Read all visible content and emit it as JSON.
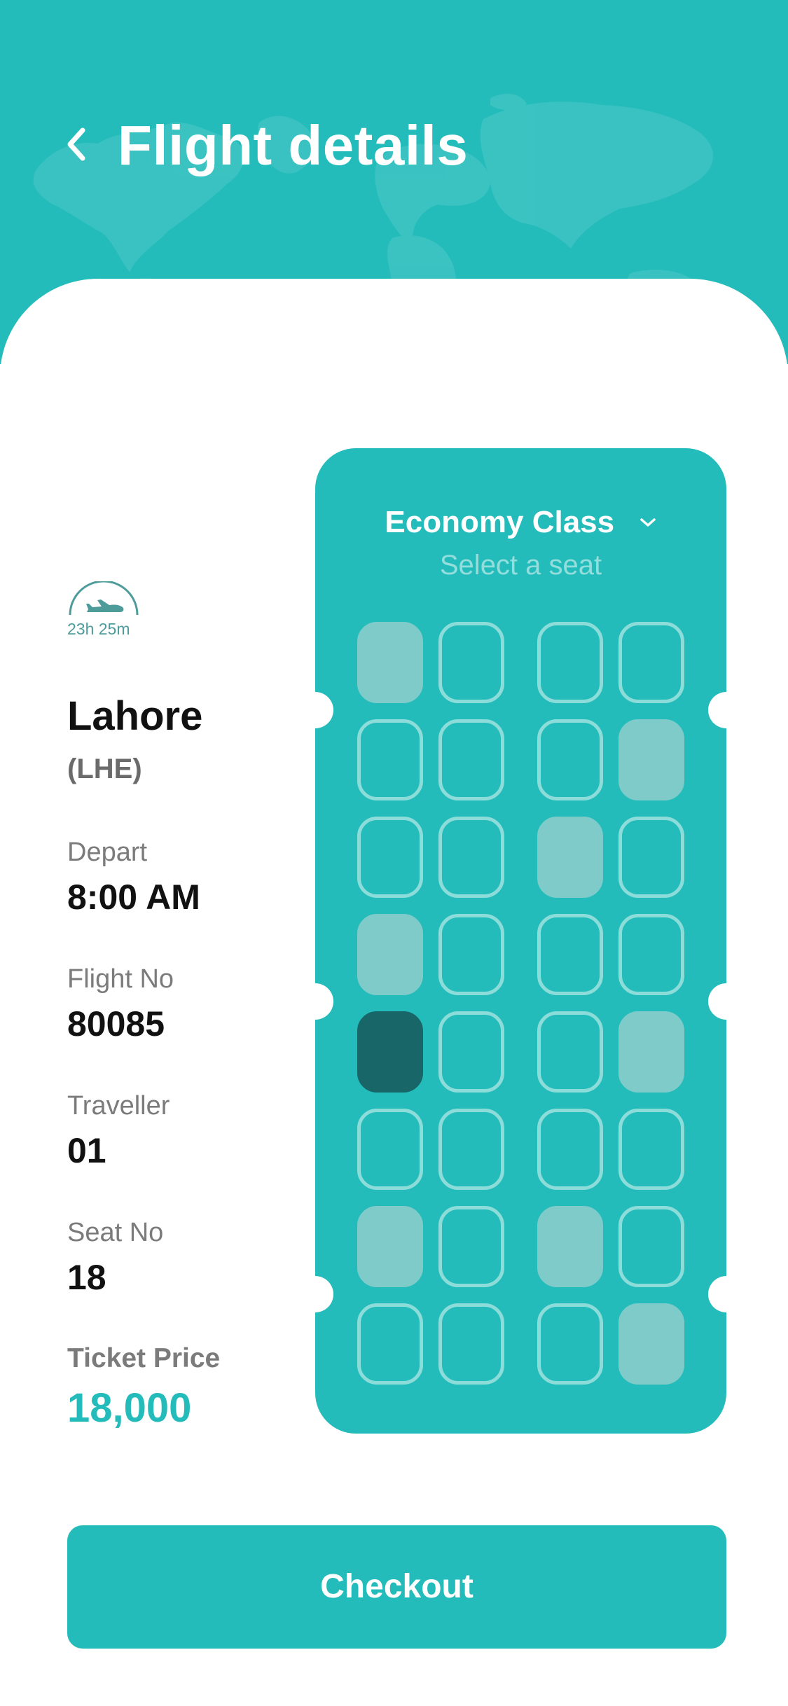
{
  "header": {
    "title": "Flight details",
    "background_color": "#23BCBA",
    "back_icon": "chevron-left-icon"
  },
  "flight": {
    "duration": "23h 25m",
    "duration_icon": "plane-departure-icon",
    "city": "Lahore",
    "code": "(LHE)",
    "depart_label": "Depart",
    "depart_value": "8:00 AM",
    "flight_no_label": "Flight No",
    "flight_no_value": "80085",
    "traveller_label": "Traveller",
    "traveller_value": "01",
    "seat_no_label": "Seat No",
    "seat_no_value": "18",
    "price_label": "Ticket Price",
    "price_value": "18,000"
  },
  "seat_map": {
    "class_label": "Economy Class",
    "class_icon": "chevron-down-icon",
    "subtitle": "Select a seat",
    "columns": 4,
    "rows": [
      [
        "taken",
        "available",
        "available",
        "available"
      ],
      [
        "available",
        "available",
        "available",
        "taken"
      ],
      [
        "available",
        "available",
        "taken",
        "available"
      ],
      [
        "taken",
        "available",
        "available",
        "available"
      ],
      [
        "selected",
        "available",
        "available",
        "taken"
      ],
      [
        "available",
        "available",
        "available",
        "available"
      ],
      [
        "taken",
        "available",
        "taken",
        "available"
      ],
      [
        "available",
        "available",
        "available",
        "taken"
      ]
    ],
    "colors": {
      "available_border": "#8CDDDA",
      "taken": "#7FCBC9",
      "selected": "#186667"
    }
  },
  "checkout": {
    "label": "Checkout"
  },
  "colors": {
    "accent": "#23BCBA",
    "text_dark": "#111111",
    "text_muted": "#7b7b7b"
  }
}
